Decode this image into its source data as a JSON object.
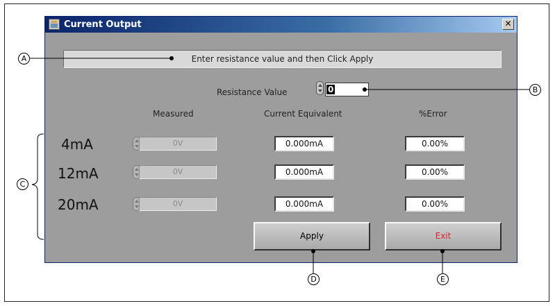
{
  "window": {
    "title": "Current Output",
    "close_label": "✕"
  },
  "status": {
    "message": "Enter resistance value and then Click Apply"
  },
  "resistance": {
    "label": "Resistance Value",
    "value": "0"
  },
  "columns": {
    "measured": "Measured",
    "current_equivalent": "Current Equivalent",
    "percent_error": "%Error"
  },
  "rows": [
    {
      "label": "4mA",
      "measured": "0V",
      "current": "0.000mA",
      "error": "0.00%"
    },
    {
      "label": "12mA",
      "measured": "0V",
      "current": "0.000mA",
      "error": "0.00%"
    },
    {
      "label": "20mA",
      "measured": "0V",
      "current": "0.000mA",
      "error": "0.00%"
    }
  ],
  "buttons": {
    "apply": "Apply",
    "exit": "Exit",
    "exit_color": "#e0202a"
  },
  "callouts": {
    "a": "A",
    "b": "B",
    "c": "C",
    "d": "D",
    "e": "E"
  }
}
